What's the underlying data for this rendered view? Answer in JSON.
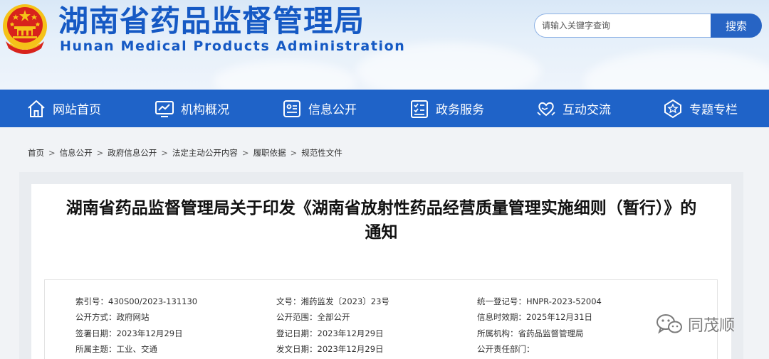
{
  "header": {
    "site_title": "湖南省药品监督管理局",
    "site_subtitle": "Hunan Medical Products Administration",
    "emblem_icon": "national-emblem-icon"
  },
  "search": {
    "placeholder": "请输入关键字查询",
    "button_label": "搜索"
  },
  "nav": {
    "items": [
      {
        "label": "网站首页",
        "icon": "home-icon"
      },
      {
        "label": "机构概况",
        "icon": "monitor-chart-icon"
      },
      {
        "label": "信息公开",
        "icon": "id-card-icon"
      },
      {
        "label": "政务服务",
        "icon": "checklist-icon"
      },
      {
        "label": "互动交流",
        "icon": "heart-hands-icon"
      },
      {
        "label": "专题专栏",
        "icon": "star-badge-icon"
      }
    ]
  },
  "breadcrumb": {
    "items": [
      "首页",
      "信息公开",
      "政府信息公开",
      "法定主动公开内容",
      "履职依据",
      "规范性文件"
    ],
    "separator": ">"
  },
  "article": {
    "title_line1": "湖南省药品监督管理局关于印发《湖南省放射性药品经营质量管理实施细则（暂行）》的",
    "title_line2": "通知"
  },
  "meta": {
    "rows": [
      [
        "索引号：430S00/2023-131130",
        "文号：湘药监发〔2023〕23号",
        "统一登记号：HNPR-2023-52004"
      ],
      [
        "公开方式：政府网站",
        "公开范围：全部公开",
        "信息时效期：2025年12月31日"
      ],
      [
        "签署日期：2023年12月29日",
        "登记日期：2023年12月29日",
        "所属机构：省药品监督管理局"
      ],
      [
        "所属主题：工业、交通",
        "发文日期：2023年12月29日",
        "公开责任部门："
      ]
    ]
  },
  "watermark": {
    "text": "同茂顺",
    "icon": "wechat-icon"
  },
  "colors": {
    "brand_blue": "#1f63c8",
    "title_blue": "#1559c4",
    "emblem_red": "#d8231c",
    "emblem_gold": "#f5c218"
  }
}
